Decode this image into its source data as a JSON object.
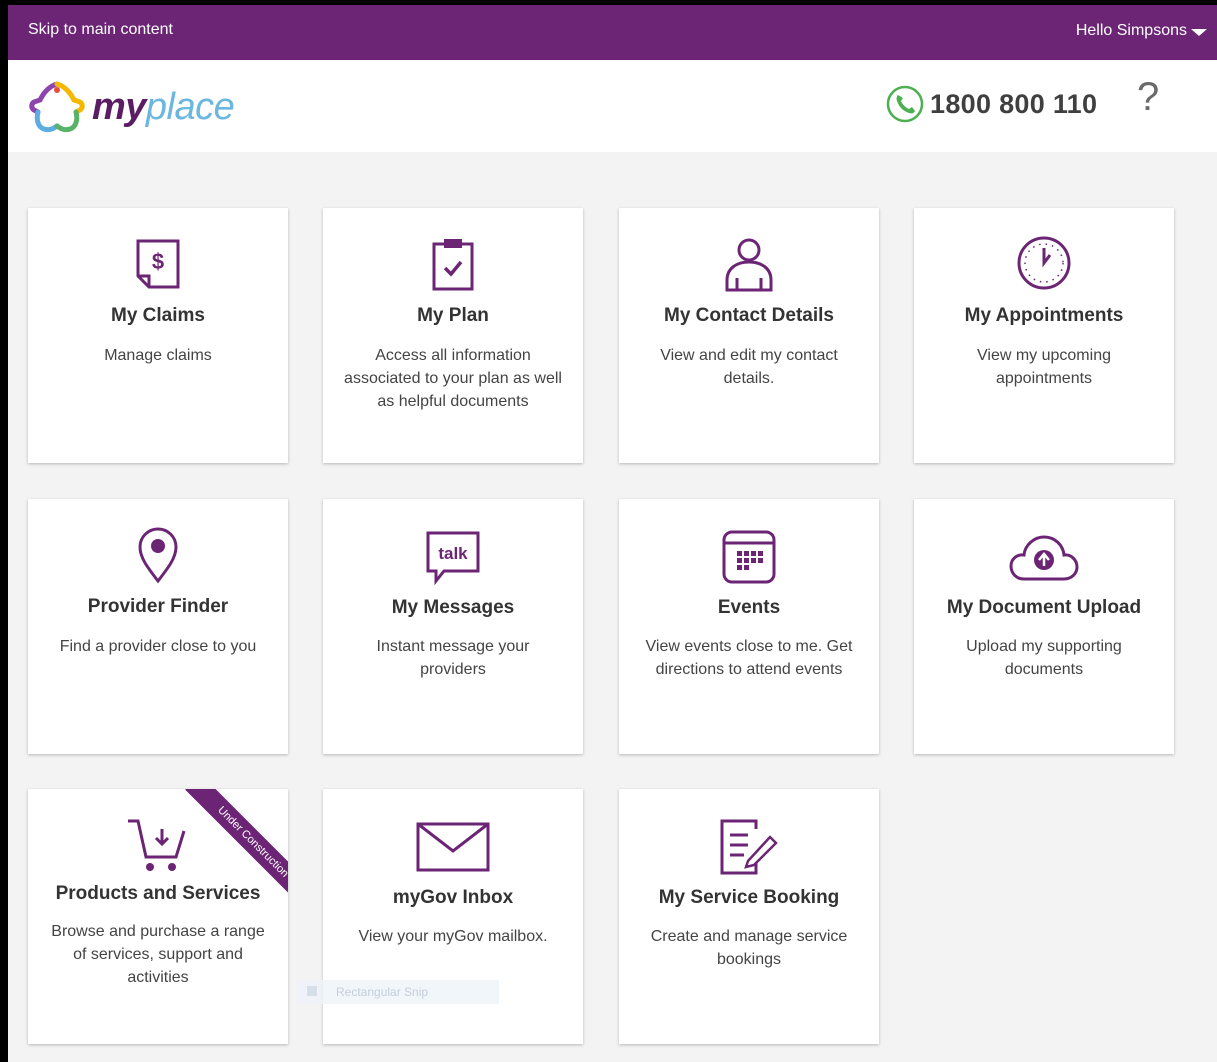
{
  "topbar": {
    "skip_link": "Skip to main content",
    "greeting": "Hello Simpsons"
  },
  "header": {
    "logo": {
      "my": "my",
      "place": "place"
    },
    "phone_number": "1800 800 110",
    "help_label": "?"
  },
  "tiles": [
    {
      "title": "My Claims",
      "description": "Manage claims",
      "icon": "claims-document-dollar-icon"
    },
    {
      "title": "My Plan",
      "description": "Access all information associated to your plan as well as helpful documents",
      "icon": "clipboard-check-icon"
    },
    {
      "title": "My Contact Details",
      "description": "View and edit my contact details.",
      "icon": "person-icon"
    },
    {
      "title": "My Appointments",
      "description": "View my upcoming appointments",
      "icon": "clock-icon"
    },
    {
      "title": "Provider Finder",
      "description": "Find a provider close to you",
      "icon": "map-pin-icon"
    },
    {
      "title": "My Messages",
      "description": "Instant message your providers",
      "icon": "talk-bubble-icon",
      "icon_text": "talk"
    },
    {
      "title": "Events",
      "description": "View events close to me. Get directions to attend events",
      "icon": "calendar-icon"
    },
    {
      "title": "My Document Upload",
      "description": "Upload my supporting documents",
      "icon": "cloud-upload-icon"
    },
    {
      "title": "Products and Services",
      "description": "Browse and purchase a range of services, support and activities",
      "icon": "shopping-cart-icon",
      "ribbon": "Under Construction"
    },
    {
      "title": "myGov Inbox",
      "description": "View your myGov mailbox.",
      "icon": "envelope-icon"
    },
    {
      "title": "My Service Booking",
      "description": "Create and manage service bookings",
      "icon": "document-edit-icon"
    }
  ],
  "overlay": {
    "snip_label": "Rectangular Snip"
  },
  "colors": {
    "brand_purple": "#6b2574",
    "icon_purple": "#6b2574",
    "phone_green": "#4caf50",
    "logo_blue": "#6bb7e0"
  }
}
